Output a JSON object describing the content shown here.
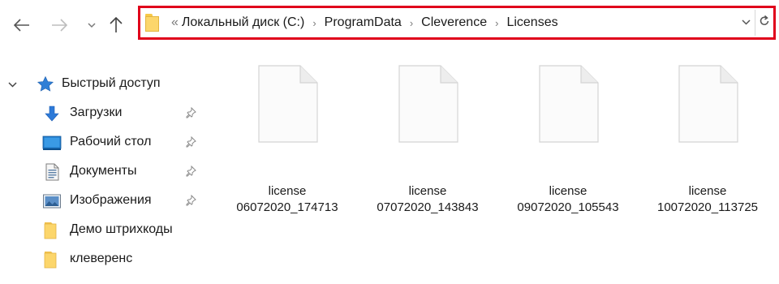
{
  "nav": {
    "back_icon": "arrow-left-icon",
    "forward_icon": "arrow-right-icon",
    "recent_icon": "chevron-down-icon",
    "up_icon": "arrow-up-icon"
  },
  "address": {
    "overflow": "«",
    "segments": [
      "Локальный диск (C:)",
      "ProgramData",
      "Cleverence",
      "Licenses"
    ],
    "highlight_color": "#e0001b"
  },
  "sidebar": {
    "quick_access": "Быстрый доступ",
    "items": [
      {
        "label": "Загрузки",
        "icon": "download-icon",
        "pinned": true
      },
      {
        "label": "Рабочий стол",
        "icon": "desktop-icon",
        "pinned": true
      },
      {
        "label": "Документы",
        "icon": "documents-icon",
        "pinned": true
      },
      {
        "label": "Изображения",
        "icon": "pictures-icon",
        "pinned": true
      },
      {
        "label": "Демо штрихкоды",
        "icon": "folder-icon",
        "pinned": false
      },
      {
        "label": "клеверенс",
        "icon": "folder-icon",
        "pinned": false
      }
    ]
  },
  "files": [
    {
      "line1": "license",
      "line2": "06072020_174713"
    },
    {
      "line1": "license",
      "line2": "07072020_143843"
    },
    {
      "line1": "license",
      "line2": "09072020_105543"
    },
    {
      "line1": "license",
      "line2": "10072020_113725"
    }
  ]
}
